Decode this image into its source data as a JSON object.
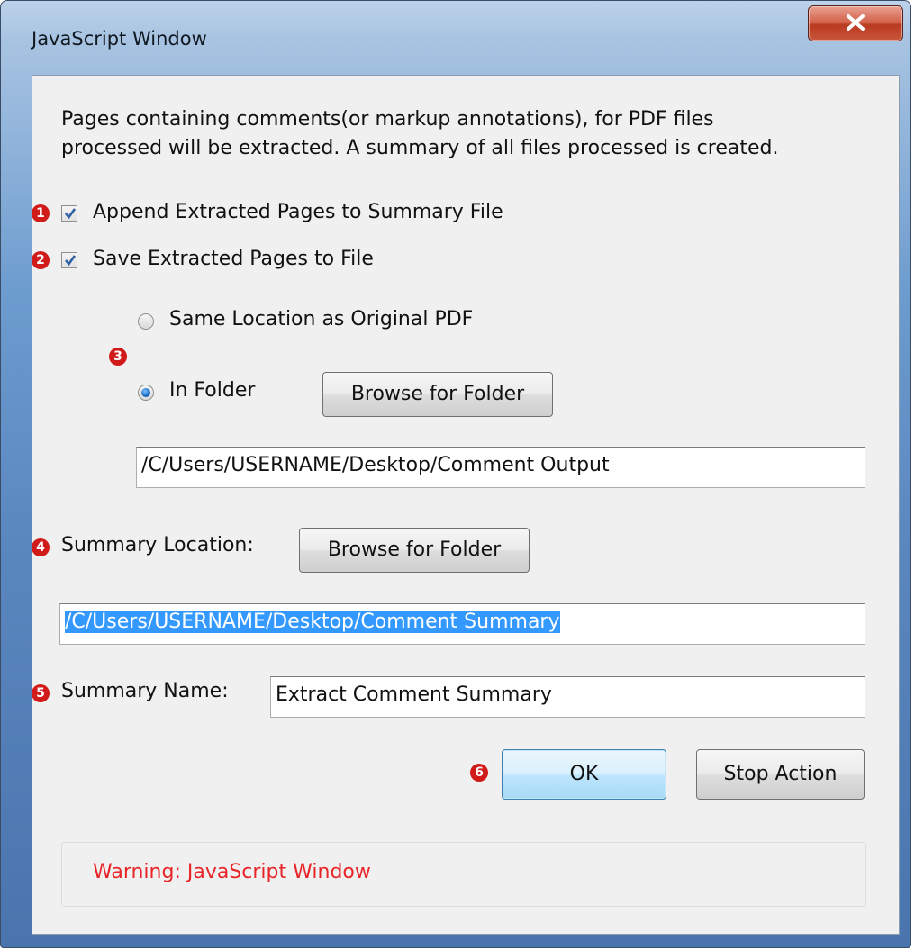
{
  "window": {
    "title": "JavaScript Window",
    "close_icon": "close-x-icon"
  },
  "description": {
    "line1": "Pages containing comments(or markup annotations), for PDF files",
    "line2": "processed will be extracted.  A summary of all files processed is created."
  },
  "markers": [
    "1",
    "2",
    "3",
    "4",
    "5",
    "6"
  ],
  "options": {
    "append_label": "Append Extracted Pages to Summary File",
    "append_checked": true,
    "save_label": "Save Extracted Pages to File",
    "save_checked": true
  },
  "location": {
    "same_label": "Same Location as Original PDF",
    "folder_label": "In Folder",
    "selected": "In Folder",
    "browse_label": "Browse for Folder",
    "folder_path": "/C/Users/USERNAME/Desktop/Comment Output"
  },
  "summary": {
    "location_label": "Summary Location:",
    "browse_label": "Browse for Folder",
    "location_path": "/C/Users/USERNAME/Desktop/Comment Summary",
    "name_label": "Summary Name:",
    "name_value": "Extract Comment Summary"
  },
  "actions": {
    "ok_label": "OK",
    "stop_label": "Stop Action"
  },
  "warning": {
    "text": "Warning: JavaScript Window",
    "color": "#e8262a"
  },
  "colors": {
    "marker": "#d11a1a",
    "selection": "#3399ff"
  }
}
